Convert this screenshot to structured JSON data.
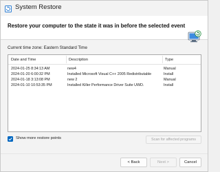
{
  "window": {
    "title": "System Restore",
    "icon": "system-restore-icon"
  },
  "header": {
    "heading": "Restore your computer to the state it was in before the selected event",
    "icon": "restore-computer-icon"
  },
  "timezone": "Current time zone: Eastern Standard Time",
  "table": {
    "columns": [
      "Date and Time",
      "Description",
      "Type"
    ],
    "rows": [
      {
        "date": "2024-01-25 8:34:13 AM",
        "description": "new4",
        "type": "Manual"
      },
      {
        "date": "2024-01-20 6:00:32 PM",
        "description": "Installed Microsoft Visual C++ 2005 Redistributable",
        "type": "Install"
      },
      {
        "date": "2024-01-18 3:13:08 PM",
        "description": "new 2",
        "type": "Manual"
      },
      {
        "date": "2024-01-10 10:53:35 PM",
        "description": "Installed Killer Performance Driver Suite UWD.",
        "type": "Install"
      }
    ]
  },
  "options": {
    "show_more_label": "Show more restore points",
    "show_more_checked": true,
    "scan_label": "Scan for affected programs"
  },
  "footer": {
    "back_label": "< Back",
    "next_label": "Next >",
    "cancel_label": "Cancel"
  },
  "colors": {
    "accent": "#0067c0"
  }
}
